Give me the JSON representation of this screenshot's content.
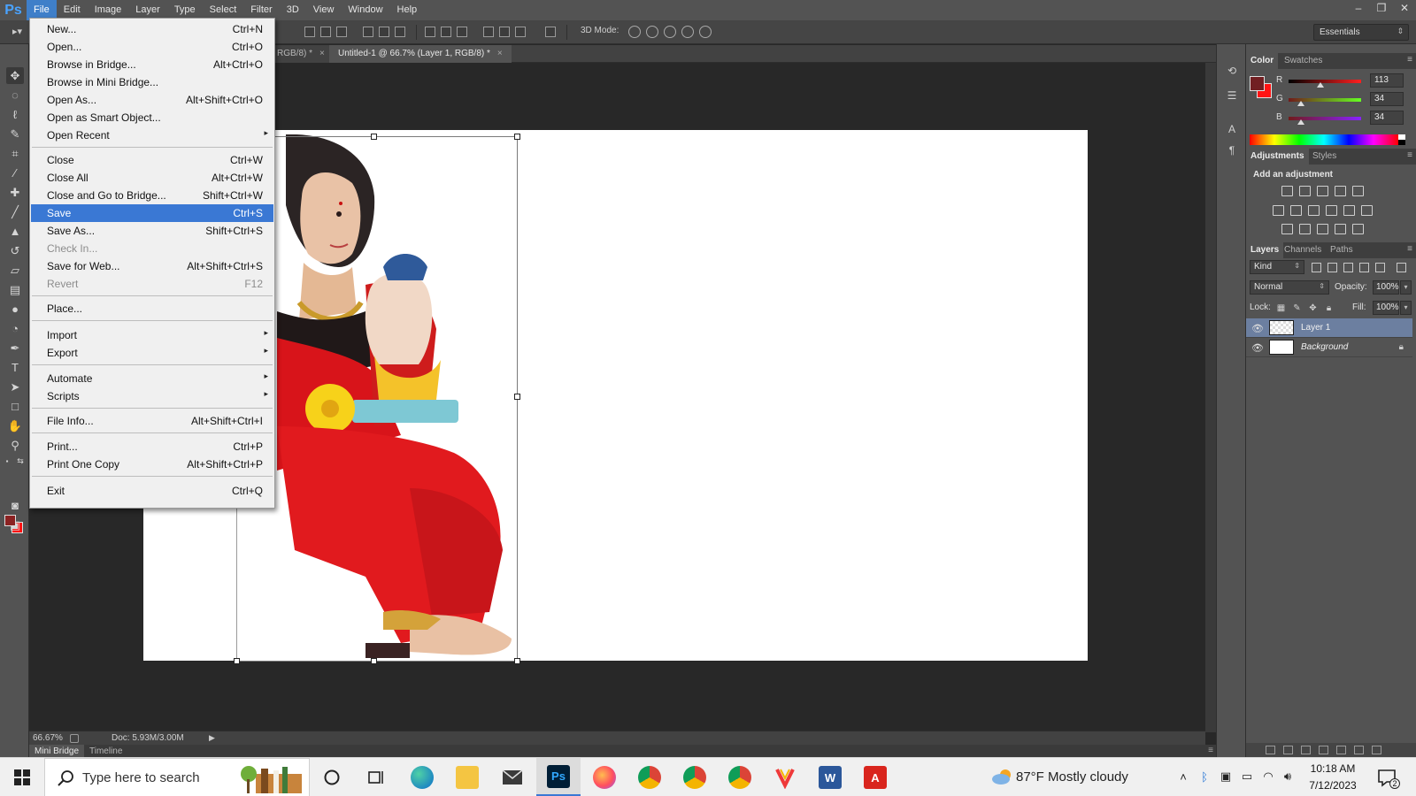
{
  "app": {
    "logo": "Ps",
    "name": "Adobe Photoshop"
  },
  "menubar": {
    "items": [
      "File",
      "Edit",
      "Image",
      "Layer",
      "Type",
      "Select",
      "Filter",
      "3D",
      "View",
      "Window",
      "Help"
    ],
    "active": "File"
  },
  "window_controls": {
    "minimize": "–",
    "restore": "❐",
    "close": "✕"
  },
  "options_bar": {
    "mode3d_label": "3D Mode:",
    "workspace": "Essentials"
  },
  "doc_tabs": [
    {
      "label": "RGB/8) *",
      "close": "×"
    },
    {
      "label": "Untitled-1 @ 66.7% (Layer 1, RGB/8) *",
      "close": "×"
    }
  ],
  "file_menu": {
    "items": [
      {
        "label": "New...",
        "shortcut": "Ctrl+N"
      },
      {
        "label": "Open...",
        "shortcut": "Ctrl+O"
      },
      {
        "label": "Browse in Bridge...",
        "shortcut": "Alt+Ctrl+O"
      },
      {
        "label": "Browse in Mini Bridge...",
        "shortcut": ""
      },
      {
        "label": "Open As...",
        "shortcut": "Alt+Shift+Ctrl+O"
      },
      {
        "label": "Open as Smart Object...",
        "shortcut": ""
      },
      {
        "label": "Open Recent",
        "shortcut": "",
        "submenu": "▸"
      },
      {
        "label": "Close",
        "shortcut": "Ctrl+W"
      },
      {
        "label": "Close All",
        "shortcut": "Alt+Ctrl+W"
      },
      {
        "label": "Close and Go to Bridge...",
        "shortcut": "Shift+Ctrl+W"
      },
      {
        "label": "Save",
        "shortcut": "Ctrl+S"
      },
      {
        "label": "Save As...",
        "shortcut": "Shift+Ctrl+S"
      },
      {
        "label": "Check In...",
        "shortcut": ""
      },
      {
        "label": "Save for Web...",
        "shortcut": "Alt+Shift+Ctrl+S"
      },
      {
        "label": "Revert",
        "shortcut": "F12"
      },
      {
        "label": "Place...",
        "shortcut": ""
      },
      {
        "label": "Import",
        "shortcut": "",
        "submenu": "▸"
      },
      {
        "label": "Export",
        "shortcut": "",
        "submenu": "▸"
      },
      {
        "label": "Automate",
        "shortcut": "",
        "submenu": "▸"
      },
      {
        "label": "Scripts",
        "shortcut": "",
        "submenu": "▸"
      },
      {
        "label": "File Info...",
        "shortcut": "Alt+Shift+Ctrl+I"
      },
      {
        "label": "Print...",
        "shortcut": "Ctrl+P"
      },
      {
        "label": "Print One Copy",
        "shortcut": "Alt+Shift+Ctrl+P"
      },
      {
        "label": "Exit",
        "shortcut": "Ctrl+Q"
      }
    ],
    "highlighted": "Save",
    "disabled": [
      "Check In...",
      "Revert"
    ]
  },
  "status_bar": {
    "zoom": "66.67%",
    "doc_size": "Doc: 5.93M/3.00M",
    "arrow": "▶"
  },
  "bottom_tabs": [
    "Mini Bridge",
    "Timeline"
  ],
  "color_panel": {
    "tabs": [
      "Color",
      "Swatches"
    ],
    "fg_color": "#711f22",
    "bg_color": "#ff1313",
    "channels": [
      {
        "label": "R",
        "value": "113"
      },
      {
        "label": "G",
        "value": "34"
      },
      {
        "label": "B",
        "value": "34"
      }
    ]
  },
  "adjustments_panel": {
    "tabs": [
      "Adjustments",
      "Styles"
    ],
    "title": "Add an adjustment"
  },
  "layers_panel": {
    "tabs": [
      "Layers",
      "Channels",
      "Paths"
    ],
    "kind": "Kind",
    "blend_mode": "Normal",
    "opacity_label": "Opacity:",
    "opacity": "100%",
    "lock_label": "Lock:",
    "fill_label": "Fill:",
    "fill": "100%",
    "layers": [
      {
        "name": "Layer 1",
        "selected": true
      },
      {
        "name": "Background",
        "selected": false
      }
    ]
  },
  "taskbar": {
    "search_placeholder": "Type here to search",
    "weather": "87°F  Mostly cloudy",
    "time": "10:18 AM",
    "date": "7/12/2023",
    "notification_count": "2",
    "apps": [
      "cortana",
      "task-view",
      "edge",
      "file-explorer",
      "mail",
      "photoshop",
      "firefox",
      "chrome-profile-1",
      "chrome-profile-2",
      "chrome-profile-3",
      "vivaldi",
      "word",
      "acrobat"
    ]
  }
}
